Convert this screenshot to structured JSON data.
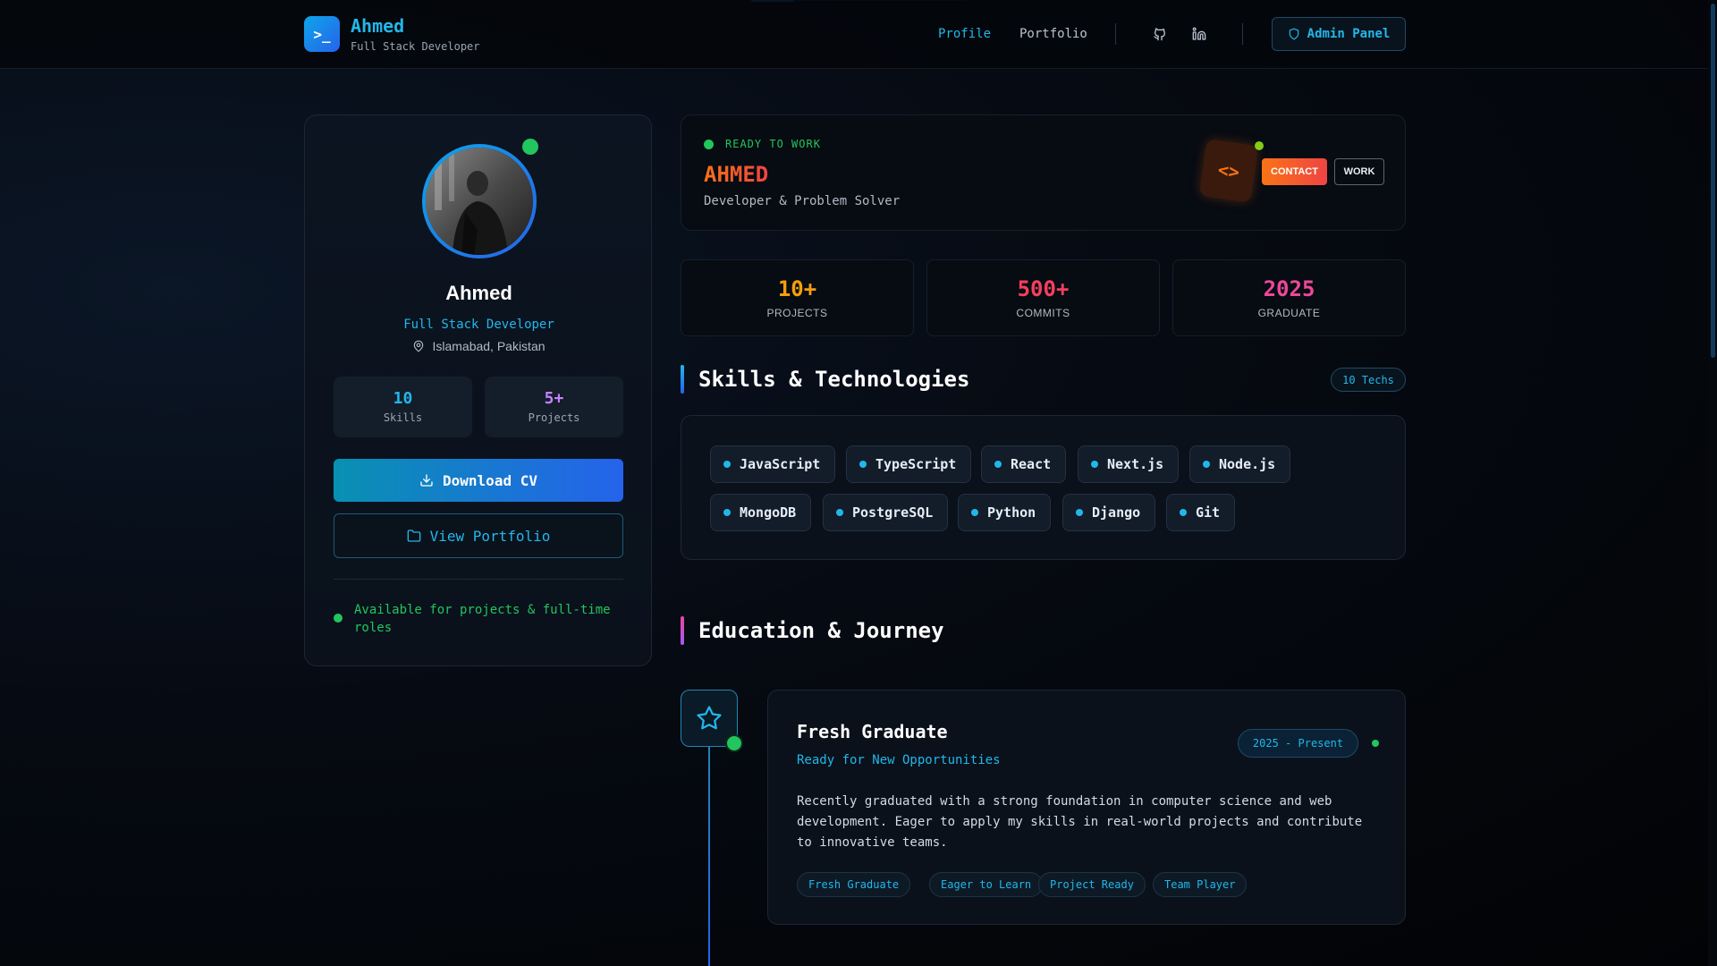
{
  "header": {
    "brand_name": "Ahmed",
    "brand_sub": "Full Stack Developer",
    "logo_glyph": ">_",
    "nav": [
      {
        "label": "Profile",
        "active": true
      },
      {
        "label": "Portfolio",
        "active": false
      }
    ],
    "social_icons": [
      "github-icon",
      "linkedin-icon"
    ],
    "admin_label": "Admin Panel"
  },
  "profile": {
    "name": "Ahmed",
    "role": "Full Stack Developer",
    "location": "Islamabad, Pakistan",
    "stats": [
      {
        "value": "10",
        "label": "Skills",
        "color": "#22b7ea"
      },
      {
        "value": "5+",
        "label": "Projects",
        "color": "#c084fc"
      }
    ],
    "download_label": "Download CV",
    "portfolio_label": "View Portfolio",
    "availability": "Available for projects & full-time roles"
  },
  "hero": {
    "status": "READY TO WORK",
    "name": "AHMED",
    "subtitle": "Developer & Problem Solver",
    "code_glyph": "<>",
    "contact_label": "CONTACT",
    "work_label": "WORK"
  },
  "stats": [
    {
      "value": "10+",
      "label": "PROJECTS",
      "color": "#f59e0b"
    },
    {
      "value": "500+",
      "label": "COMMITS",
      "color": "#f43f5e"
    },
    {
      "value": "2025",
      "label": "GRADUATE",
      "color": "#ec4899"
    }
  ],
  "skills": {
    "title": "Skills & Technologies",
    "badge": "10 Techs",
    "items": [
      "JavaScript",
      "TypeScript",
      "React",
      "Next.js",
      "Node.js",
      "MongoDB",
      "PostgreSQL",
      "Python",
      "Django",
      "Git"
    ]
  },
  "education": {
    "title": "Education & Journey",
    "card": {
      "title": "Fresh Graduate",
      "subtitle": "Ready for New Opportunities",
      "date": "2025 - Present",
      "description": "Recently graduated with a strong foundation in computer science and web development. Eager to apply my skills in real-world projects and contribute to innovative teams.",
      "tags": [
        "Fresh Graduate",
        "Eager to Learn",
        "Project Ready",
        "Team Player"
      ]
    }
  },
  "colors": {
    "accent": "#22b7ea",
    "success": "#22c55e",
    "orange": "#f97316"
  }
}
